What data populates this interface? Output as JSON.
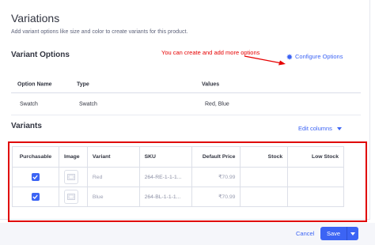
{
  "page": {
    "title": "Variations",
    "subtitle": "Add variant options like size and color to create variants for this product."
  },
  "variant_options": {
    "title": "Variant Options",
    "annotation": "You can create and add more options",
    "configure_label": "Configure Options",
    "columns": [
      "Option Name",
      "Type",
      "Values"
    ],
    "rows": [
      {
        "name": "Swatch",
        "type": "Swatch",
        "values": "Red, Blue"
      }
    ]
  },
  "variants": {
    "title": "Variants",
    "edit_columns_label": "Edit columns",
    "columns": [
      "Purchasable",
      "Image",
      "Variant",
      "SKU",
      "Default Price",
      "Stock",
      "Low Stock"
    ],
    "rows": [
      {
        "purchasable": true,
        "variant": "Red",
        "sku": "264-RE-1-1-1...",
        "price": "₹70.99",
        "stock": "",
        "low_stock": ""
      },
      {
        "purchasable": true,
        "variant": "Blue",
        "sku": "264-BL-1-1-1...",
        "price": "₹70.99",
        "stock": "",
        "low_stock": ""
      }
    ]
  },
  "footer": {
    "cancel_label": "Cancel",
    "save_label": "Save"
  },
  "colors": {
    "accent": "#3c64f4",
    "annotation": "#e60000",
    "highlight_box": "#e00000"
  },
  "icons": [
    "gear-icon",
    "chevron-down-icon",
    "checkbox-checked-icon",
    "image-placeholder-icon",
    "arrow-icon"
  ]
}
